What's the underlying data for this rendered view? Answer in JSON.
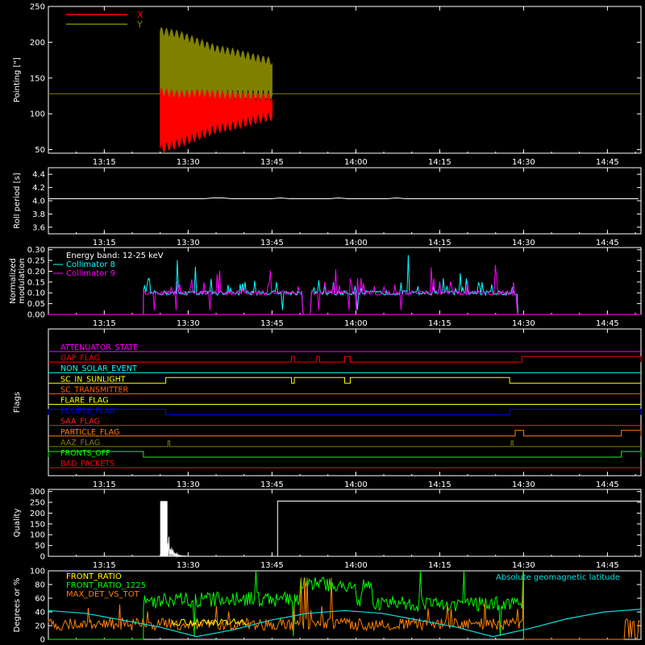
{
  "chart_data": [
    {
      "type": "line",
      "ylabel": "Pointing [\"]",
      "ylim": [
        45,
        250
      ],
      "yticks": [
        50,
        100,
        150,
        200,
        250
      ],
      "xlim": [
        "13:05",
        "14:51"
      ],
      "xticks": [
        "13:15",
        "13:30",
        "13:45",
        "14:00",
        "14:15",
        "14:30",
        "14:45"
      ],
      "reference_level": 128,
      "series": [
        {
          "name": "X",
          "color": "#ff0000",
          "x_range": [
            "13:25",
            "13:45"
          ],
          "values_high": [
            130,
            126,
            128,
            126,
            124,
            123,
            122
          ],
          "values_low": [
            52,
            60,
            70,
            80,
            85,
            92,
            98
          ]
        },
        {
          "name": "Y",
          "color": "#808000",
          "x_range": [
            "13:25",
            "13:45"
          ],
          "values_high": [
            215,
            210,
            200,
            190,
            185,
            178,
            172
          ],
          "values_low": [
            128,
            128,
            128,
            128,
            128,
            128,
            128
          ]
        }
      ]
    },
    {
      "type": "line",
      "ylabel": "Roll period [s]",
      "ylim": [
        3.5,
        4.5
      ],
      "yticks": [
        "3.6",
        "3.8",
        "4.0",
        "4.2",
        "4.4"
      ],
      "xticks": [
        "13:15",
        "13:30",
        "13:45",
        "14:00",
        "14:15",
        "14:30",
        "14:45"
      ],
      "series": [
        {
          "name": "",
          "color": "#ffffff",
          "x_range": [
            "13:05",
            "14:51"
          ],
          "values": [
            4.03
          ]
        }
      ]
    },
    {
      "type": "line",
      "ylabel": "Normalized modulation",
      "ylim": [
        0,
        0.31
      ],
      "yticks": [
        "0.00",
        "0.05",
        "0.10",
        "0.15",
        "0.20",
        "0.25",
        "0.30"
      ],
      "xticks": [
        "13:15",
        "13:30",
        "13:45",
        "14:00",
        "14:15",
        "14:30",
        "14:45"
      ],
      "legend_title": "Energy band: 12-25 keV",
      "series": [
        {
          "name": "Collimator 8",
          "color": "#00ffff",
          "x_range": [
            "13:22",
            "14:29"
          ],
          "baseline": 0.1
        },
        {
          "name": "Collimator 9",
          "color": "#ff00ff",
          "x_range": [
            "13:22",
            "14:29"
          ],
          "baseline": 0.1
        }
      ]
    },
    {
      "type": "line",
      "ylabel": "Flags",
      "xticks": [
        "13:15",
        "13:30",
        "13:45",
        "14:00",
        "14:15",
        "14:30",
        "14:45"
      ],
      "flags": [
        {
          "name": "ATTENUATOR_STATE",
          "color": "#ff00ff",
          "segments": []
        },
        {
          "name": "GAP_FLAG",
          "color": "#ff0000",
          "segments": [
            [
              "13:48.5",
              "13:49"
            ],
            [
              "13:53",
              "13:53.5"
            ],
            [
              "13:58",
              "13:59"
            ],
            [
              "14:29.7",
              "14:51"
            ]
          ]
        },
        {
          "name": "NON_SOLAR_EVENT",
          "color": "#00ffff",
          "segments": []
        },
        {
          "name": "SC_IN_SUNLIGHT",
          "color": "#ffff00",
          "segments": [
            [
              "13:26",
              "13:48.5"
            ],
            [
              "13:49",
              "13:58"
            ],
            [
              "13:59",
              "14:27.5"
            ]
          ]
        },
        {
          "name": "SC_TRANSMITTER",
          "color": "#ff6000",
          "segments": []
        },
        {
          "name": "FLARE_FLAG",
          "color": "#ffff00",
          "segments": []
        },
        {
          "name": "ECLIPSE_FLAG",
          "color": "#0000ff",
          "segments": [
            [
              "13:05",
              "13:26"
            ],
            [
              "14:27.5",
              "14:51"
            ]
          ]
        },
        {
          "name": "SAA_FLAG",
          "color": "#ff2020",
          "segments": []
        },
        {
          "name": "PARTICLE_FLAG",
          "color": "#ff8000",
          "segments": [
            [
              "14:28.5",
              "14:30"
            ],
            [
              "14:47.5",
              "14:51"
            ]
          ]
        },
        {
          "name": "AAZ_FLAG",
          "color": "#808000",
          "segments": [
            [
              "13:26.4",
              "13:26.7"
            ],
            [
              "14:27.8",
              "14:28.1"
            ]
          ]
        },
        {
          "name": "FRONTS_OFF",
          "color": "#00ff00",
          "segments": [
            [
              "13:05",
              "13:22"
            ],
            [
              "14:47.5",
              "14:51"
            ]
          ]
        },
        {
          "name": "BAD_PACKETS",
          "color": "#ff0000",
          "segments": []
        }
      ]
    },
    {
      "type": "bar",
      "ylabel": "Quality",
      "ylim": [
        0,
        310
      ],
      "yticks": [
        0,
        50,
        100,
        150,
        200,
        250,
        300
      ],
      "xticks": [
        "13:15",
        "13:30",
        "13:45",
        "14:00",
        "14:15",
        "14:30",
        "14:45"
      ],
      "series": [
        {
          "name": "",
          "color": "#ffffff",
          "points": [
            [
              "13:25",
              0
            ],
            [
              "13:25",
              256
            ],
            [
              "13:26.3",
              256
            ],
            [
              "13:26.3",
              120
            ],
            [
              "13:26.8",
              40
            ],
            [
              "13:27.3",
              20
            ],
            [
              "13:28",
              8
            ],
            [
              "13:29",
              3
            ],
            [
              "13:30",
              0
            ],
            [
              "13:46",
              0
            ],
            [
              "13:46",
              256
            ],
            [
              "14:51",
              256
            ]
          ]
        }
      ]
    },
    {
      "type": "line",
      "ylabel": "Degrees or %",
      "ylim": [
        0,
        100
      ],
      "yticks": [
        0,
        20,
        40,
        60,
        80,
        100
      ],
      "series": [
        {
          "name": "FRONT_RATIO",
          "color": "#ffff00"
        },
        {
          "name": "FRONT_RATIO_1225",
          "color": "#00ff00"
        },
        {
          "name": "MAX_DET_VS_TOT",
          "color": "#ff8000"
        },
        {
          "name": "Absolute geomagnetic latitude",
          "color": "#00e0e0",
          "values": [
            42,
            38,
            28,
            18,
            4,
            14,
            28,
            38,
            42,
            38,
            28,
            18,
            4,
            16,
            30,
            40,
            44
          ]
        }
      ]
    }
  ]
}
